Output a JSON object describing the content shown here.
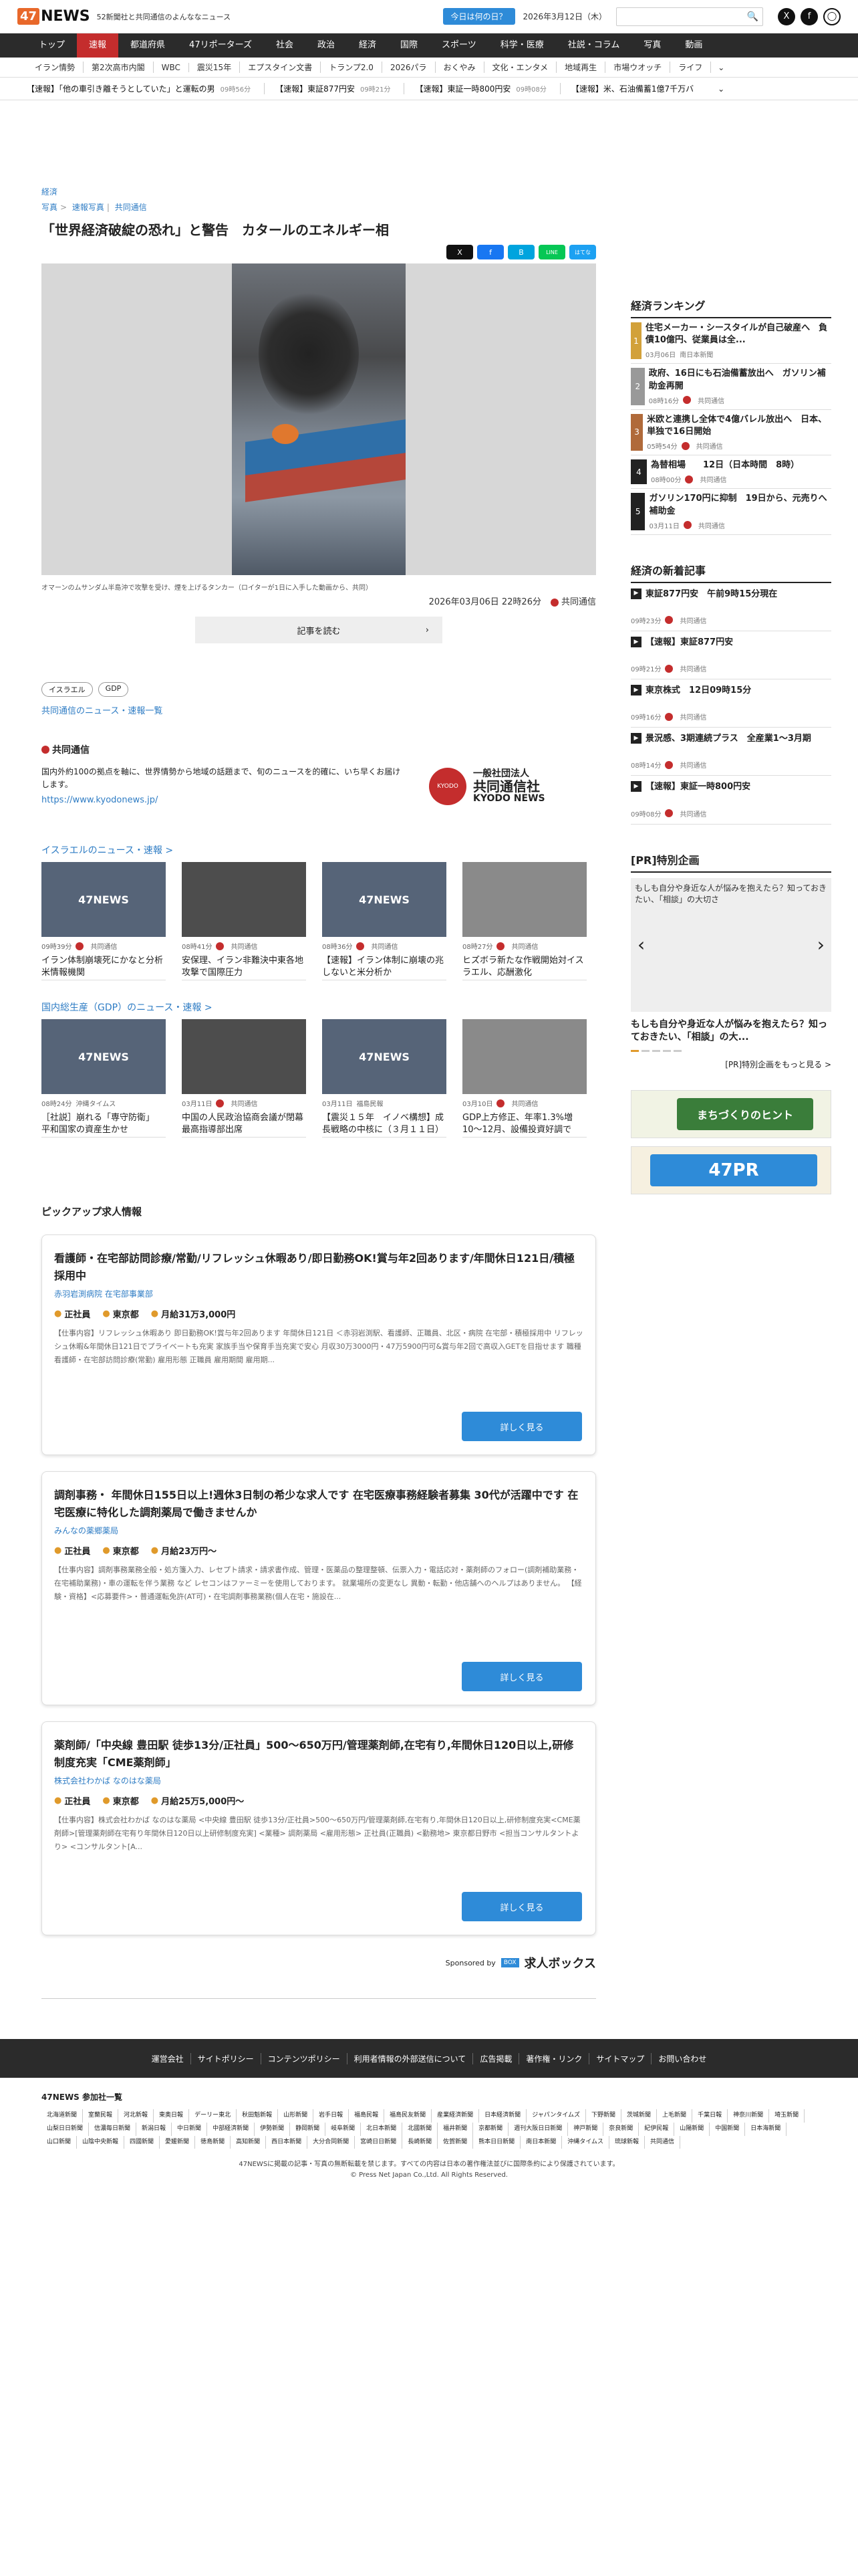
{
  "header": {
    "logo_num": "47",
    "logo_word": "NEWS",
    "tagline": "52新聞社と共同通信のよんななニュース",
    "today_btn": "今日は何の日？",
    "date": "2026年3月12日（木）"
  },
  "nav": [
    "トップ",
    "速報",
    "都道府県",
    "47リポーターズ",
    "社会",
    "政治",
    "経済",
    "国際",
    "スポーツ",
    "科学・医療",
    "社説・コラム",
    "写真",
    "動画"
  ],
  "subnav": [
    "イラン情勢",
    "第2次高市内閣",
    "WBC",
    "震災15年",
    "エプスタイン文書",
    "トランプ2.0",
    "2026パラ",
    "おくやみ",
    "文化・エンタメ",
    "地域再生",
    "市場ウオッチ",
    "ライフ"
  ],
  "ticker": [
    {
      "t": "【速報】「他の車引き離そうとしていた」と運転の男",
      "tm": "09時56分"
    },
    {
      "t": "【速報】東証877円安",
      "tm": "09時21分"
    },
    {
      "t": "【速報】東証一時800円安",
      "tm": "09時08分"
    },
    {
      "t": "【速報】米、石油備蓄1億7千万バ",
      "tm": ""
    }
  ],
  "article": {
    "category": "経済",
    "breadcrumb": [
      "写真",
      "速報写真",
      "共同通信"
    ],
    "title": "「世界経済破綻の恐れ」と警告　カタールのエネルギー相",
    "caption": "オマーンのムサンダム半島沖で攻撃を受け、煙を上げるタンカー（ロイターが1日に入手した動画から、共同）",
    "datetime": "2026年03月06日 22時26分",
    "source": "共同通信",
    "readmore": "記事を読む",
    "tags": [
      "イスラエル",
      "GDP"
    ],
    "kyodo_link": "共同通信のニュース・速報一覧"
  },
  "share": [
    "X",
    "f",
    "B",
    "LINE",
    "はてな"
  ],
  "agency": {
    "name": "共同通信",
    "desc": "国内外約100の拠点を軸に、世界情勢から地域の話題まで、旬のニュースを的確に、いち早くお届けします。",
    "url": "https://www.kyodonews.jp/",
    "logo_small": "一般社団法人",
    "logo_main": "共同通信社",
    "logo_en": "KYODO NEWS"
  },
  "israel": {
    "title": "イスラエルのニュース・速報 >",
    "items": [
      {
        "time": "09時39分",
        "src": "共同通信",
        "title": "イラン体制崩壊死にかなと分析　米情報機関"
      },
      {
        "time": "08時41分",
        "src": "共同通信",
        "title": "安保理、イラン非難決中東各地攻撃で国際圧力"
      },
      {
        "time": "08時36分",
        "src": "共同通信",
        "title": "【速報】イラン体制に崩壊の兆しないと米分析か"
      },
      {
        "time": "08時27分",
        "src": "共同通信",
        "title": "ヒズボラ新たな作戦開始対イスラエル、応酬激化"
      }
    ]
  },
  "gdp": {
    "title": "国内総生産（GDP）のニュース・速報 >",
    "items": [
      {
        "time": "08時24分",
        "src": "沖縄タイムス",
        "title": "［社説］崩れる「専守防衛」　平和国家の資産生かせ"
      },
      {
        "time": "03月11日",
        "src": "共同通信",
        "title": "中国の人民政治協商会議が閉幕　最高指導部出席"
      },
      {
        "time": "03月11日",
        "src": "福島民報",
        "title": "【震災１５年　イノベ構想】成長戦略の中核に（３月１１日）"
      },
      {
        "time": "03月10日",
        "src": "共同通信",
        "title": "GDP上方修正、年率1.3%増　10～12月、設備投資好調で"
      }
    ]
  },
  "pickup": {
    "title": "ピックアップ求人情報",
    "button": "詳しく見る",
    "sponsor_label": "Sponsored by",
    "sponsor_name": "求人ボックス",
    "jobs": [
      {
        "title": "看護師・在宅部訪問診療/常勤/リフレッシュ休暇あり/即日勤務OK!賞与年2回あります/年間休日121日/積極採用中",
        "company": "赤羽岩渕病院 在宅部事業部",
        "type": "正社員",
        "place": "東京都",
        "salary": "月給31万3,000円",
        "body": "【仕事内容】リフレッシュ休暇あり 即日勤務OK!賞与年2回あります 年間休日121日 ＜赤羽岩渕駅、看護師、正職員、北区・病院 在宅部・積極採用中 リフレッシュ休暇&年間休日121日でプライベートも充実 家族手当や保育手当充実で安心 月収30万3000円・47万5900円可&賞与年2回で高収入GETを目指せます 職種 看護師・在宅部訪問診療(常勤) 雇用形態 正職員 雇用期間 雇用期..."
      },
      {
        "title": "調剤事務・ 年間休日155日以上!週休3日制の希少な求人です 在宅医療事務経験者募集 30代が活躍中です 在宅医療に特化した調剤薬局で働きませんか",
        "company": "みんなの薬郷薬局",
        "type": "正社員",
        "place": "東京都",
        "salary": "月給23万円～",
        "body": "【仕事内容】調剤事務業務全般・処方箋入力、レセプト請求・請求書作成、管理・医薬品の整理整頓、伝票入力・電話応対・薬剤師のフォロー(調剤補助業務・在宅補助業務)・車の運転を伴う業務 など レセコンはファーミーを使用しております。 就業場所の変更なし 異動・転勤・他店舗へのヘルプはありません。 【経験・資格】<応募要件>・普通運転免許(AT可)・在宅調剤事務業務(個人在宅・施設在..."
      },
      {
        "title": "薬剤師/「中央線 豊田駅 徒歩13分/正社員」500～650万円/管理薬剤師,在宅有り,年間休日120日以上,研修制度充実「CME薬剤師」",
        "company": "株式会社わかば なのはな薬局",
        "type": "正社員",
        "place": "東京都",
        "salary": "月給25万5,000円～",
        "body": "【仕事内容】株式会社わかば なのはな薬局 <中央線 豊田駅 徒歩13分/正社員>500～650万円/管理薬剤師,在宅有り,年間休日120日以上,研修制度充実<CME薬剤師>[管理薬剤師在宅有り年間休日120日以上研修制度充実] <業種> 調剤薬局 <雇用形態> 正社員(正職員) <勤務地> 東京都日野市 <担当コンサルタントより> <コンサルタント[A..."
      }
    ]
  },
  "ranking": {
    "title": "経済ランキング",
    "items": [
      {
        "n": "1",
        "title": "住宅メーカー・シースタイルが自己破産へ　負債10億円、従業員は全...",
        "date": "03月06日",
        "src": "南日本新聞"
      },
      {
        "n": "2",
        "title": "政府、16日にも石油備蓄放出へ　ガソリン補助金再開",
        "date": "08時16分",
        "src": "共同通信"
      },
      {
        "n": "3",
        "title": "米欧と連携し全体で4億バレル放出へ　日本、単独で16日開始",
        "date": "05時54分",
        "src": "共同通信"
      },
      {
        "n": "4",
        "title": "為替相場　　12日（日本時間　8時）",
        "date": "08時00分",
        "src": "共同通信"
      },
      {
        "n": "5",
        "title": "ガソリン170円に抑制　19日から、元売りへ補助金",
        "date": "03月11日",
        "src": "共同通信"
      }
    ]
  },
  "newest": {
    "title": "経済の新着記事",
    "items": [
      {
        "title": "東証877円安　午前9時15分現在",
        "date": "09時23分",
        "src": "共同通信"
      },
      {
        "title": "【速報】東証877円安",
        "date": "09時21分",
        "src": "共同通信"
      },
      {
        "title": "東京株式　12日09時15分",
        "date": "09時16分",
        "src": "共同通信"
      },
      {
        "title": "景況感、3期連続プラス　全産業1～3月期",
        "date": "08時14分",
        "src": "共同通信"
      },
      {
        "title": "【速報】東証一時800円安",
        "date": "09時08分",
        "src": "共同通信"
      }
    ]
  },
  "pr": {
    "title": "[PR]特別企画",
    "img_alt": "もしも自分や身近な人が悩みを抱えたら？知っておきたい、「相談」の大切さ",
    "caption": "もしも自分や身近な人が悩みを抱えたら？知っておきたい、「相談」の大...",
    "more": "[PR]特別企画をもっと見る >",
    "banner1": "まちづくりのヒント",
    "banner2": "47PR"
  },
  "footer": {
    "links": [
      "運営会社",
      "サイトポリシー",
      "コンテンツポリシー",
      "利用者情報の外部送信について",
      "広告掲載",
      "著作権・リンク",
      "サイトマップ",
      "お問い合わせ"
    ],
    "members_title": "47NEWS 参加社一覧",
    "members": [
      "北海道新聞",
      "室蘭民報",
      "河北新報",
      "東奥日報",
      "デーリー東北",
      "秋田魁新報",
      "山形新聞",
      "岩手日報",
      "福島民報",
      "福島民友新聞",
      "産業経済新聞",
      "日本経済新聞",
      "ジャパンタイムズ",
      "下野新聞",
      "茨城新聞",
      "上毛新聞",
      "千葉日報",
      "神奈川新聞",
      "埼玉新聞",
      "山梨日日新聞",
      "信濃毎日新聞",
      "新潟日報",
      "中日新聞",
      "中部経済新聞",
      "伊勢新聞",
      "静岡新聞",
      "岐阜新聞",
      "北日本新聞",
      "北國新聞",
      "福井新聞",
      "京都新聞",
      "週刊大阪日日新聞",
      "神戸新聞",
      "奈良新聞",
      "紀伊民報",
      "山陽新聞",
      "中国新聞",
      "日本海新聞",
      "山口新聞",
      "山陰中央新報",
      "四國新聞",
      "愛媛新聞",
      "徳島新聞",
      "高知新聞",
      "西日本新聞",
      "大分合同新聞",
      "宮崎日日新聞",
      "長崎新聞",
      "佐賀新聞",
      "熊本日日新聞",
      "南日本新聞",
      "沖縄タイムス",
      "琉球新報",
      "共同通信"
    ],
    "notice": "47NEWSに掲載の記事・写真の無断転載を禁じます。すべての内容は日本の著作権法並びに国際条約により保護されています。",
    "copyright": "© Press Net Japan Co.,Ltd. All Rights Reserved."
  }
}
